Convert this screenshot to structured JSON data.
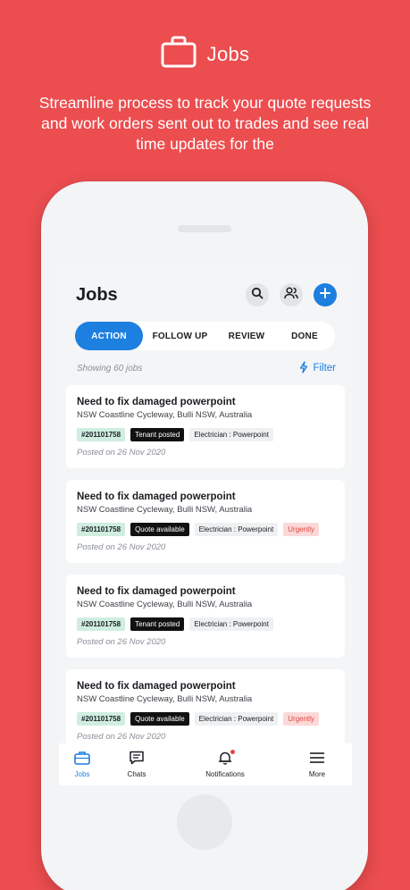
{
  "hero": {
    "title": "Jobs",
    "subtitle": "Streamline process to track your quote requests and work orders sent out to trades and see real time updates for the"
  },
  "app": {
    "title": "Jobs",
    "icons": [
      "search-icon",
      "users-icon",
      "plus-icon"
    ]
  },
  "tabs": [
    {
      "label": "ACTION",
      "active": true
    },
    {
      "label": "FOLLOW UP",
      "active": false
    },
    {
      "label": "REVIEW",
      "active": false
    },
    {
      "label": "DONE",
      "active": false
    }
  ],
  "list_meta": {
    "showing": "Showing 60 jobs",
    "filter_label": "Filter"
  },
  "jobs": [
    {
      "title": "Need to fix damaged powerpoint",
      "address": "NSW Coastline Cycleway, Bulli NSW, Australia",
      "id": "#201101758",
      "status": "Tenant posted",
      "trade": "Electrician : Powerpoint",
      "urgent": "",
      "posted": "Posted on 26 Nov 2020"
    },
    {
      "title": "Need to fix damaged powerpoint",
      "address": "NSW Coastline Cycleway, Bulli NSW, Australia",
      "id": "#201101758",
      "status": "Quote available",
      "trade": "Electrician : Powerpoint",
      "urgent": "Urgently",
      "posted": "Posted on 26 Nov 2020"
    },
    {
      "title": "Need to fix damaged powerpoint",
      "address": "NSW Coastline Cycleway, Bulli NSW, Australia",
      "id": "#201101758",
      "status": "Tenant posted",
      "trade": "Electrician : Powerpoint",
      "urgent": "",
      "posted": "Posted on 26 Nov 2020"
    },
    {
      "title": "Need to fix damaged powerpoint",
      "address": "NSW Coastline Cycleway, Bulli NSW, Australia",
      "id": "#201101758",
      "status": "Quote available",
      "trade": "Electrician : Powerpoint",
      "urgent": "Urgently",
      "posted": "Posted on 26 Nov 2020"
    }
  ],
  "bottom_nav": [
    {
      "label": "Jobs",
      "icon": "briefcase-icon",
      "active": true
    },
    {
      "label": "Chats",
      "icon": "chat-icon",
      "active": false
    },
    {
      "label": "Notifications",
      "icon": "bell-icon",
      "active": false,
      "badge": true
    },
    {
      "label": "More",
      "icon": "menu-icon",
      "active": false
    }
  ],
  "colors": {
    "background": "#ec4d4f",
    "accent": "#1d7fe0",
    "urgent": "#e2473f",
    "id_tag": "#cfeee0"
  }
}
